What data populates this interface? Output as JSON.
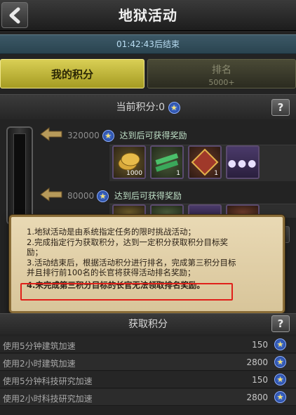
{
  "header": {
    "title": "地狱活动",
    "back_icon": "back-arrow-icon"
  },
  "timer": {
    "text": "01:42:43后结束"
  },
  "tabs": [
    {
      "label": "我的积分",
      "active": true
    },
    {
      "label": "排名",
      "sub": "5000+",
      "active": false
    }
  ],
  "score": {
    "label": "当前积分:0"
  },
  "help_label": "?",
  "rewards": [
    {
      "threshold": "320000",
      "text": "达到后可获得奖励",
      "items": [
        {
          "icon": "gold-coin-icon",
          "count": "1000"
        },
        {
          "icon": "speedup-24h-icon",
          "count": "1"
        },
        {
          "icon": "vip-points-icon",
          "count": "1"
        },
        {
          "icon": "more-icon",
          "count": ""
        }
      ]
    },
    {
      "threshold": "80000",
      "text": "达到后可获得奖励",
      "items": [
        {
          "icon": "item-icon",
          "count": ""
        },
        {
          "icon": "item-icon",
          "count": ""
        },
        {
          "icon": "item-icon",
          "count": ""
        },
        {
          "icon": "item-icon",
          "count": ""
        }
      ]
    }
  ],
  "modal": {
    "lines": [
      "1.地狱活动是由系统指定任务的限时挑战活动；",
      "2.完成指定行为获取积分，达到一定积分获取积分目标奖",
      "励；",
      "3.活动结束后，根据活动积分进行排名，完成第三积分目标",
      "并且排行前100名的长官将获得活动排名奖励；",
      "4.未完成第三积分目标的长官无法领取排名奖励。"
    ]
  },
  "gain_section": {
    "title": "获取积分",
    "rows": [
      {
        "label": "使用5分钟建筑加速",
        "points": "150"
      },
      {
        "label": "使用2小时建筑加速",
        "points": "2800"
      },
      {
        "label": "使用5分钟科技研究加速",
        "points": "150"
      },
      {
        "label": "使用2小时科技研究加速",
        "points": "2800"
      }
    ]
  },
  "colors": {
    "accent_tab": "#c9bf3f",
    "timer_bg": "#2f4a57",
    "modal_bg": "#e3d3ac",
    "highlight": "#e0201a"
  }
}
